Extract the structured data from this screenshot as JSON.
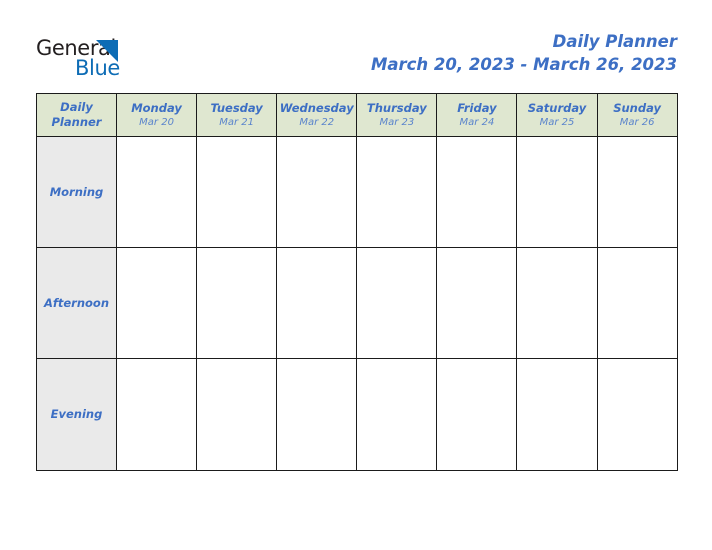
{
  "brand": {
    "name_dark": "General",
    "name_light": "Blue",
    "triangle_icon": "triangle-logo-mark",
    "dark_color": "#231f20",
    "light_color": "#0d6cb5"
  },
  "header": {
    "title": "Daily Planner",
    "date_range": "March 20, 2023 - March 26, 2023",
    "accent_color": "#3d6fc4"
  },
  "table": {
    "corner": {
      "line1": "Daily",
      "line2": "Planner"
    },
    "header_bg": "#dfe7d0",
    "label_bg": "#eaeaea",
    "border_color": "#1b1b1b",
    "columns": [
      {
        "day": "Monday",
        "date": "Mar 20"
      },
      {
        "day": "Tuesday",
        "date": "Mar 21"
      },
      {
        "day": "Wednesday",
        "date": "Mar 22"
      },
      {
        "day": "Thursday",
        "date": "Mar 23"
      },
      {
        "day": "Friday",
        "date": "Mar 24"
      },
      {
        "day": "Saturday",
        "date": "Mar 25"
      },
      {
        "day": "Sunday",
        "date": "Mar 26"
      }
    ],
    "rows": [
      {
        "label": "Morning",
        "cells": [
          "",
          "",
          "",
          "",
          "",
          "",
          ""
        ]
      },
      {
        "label": "Afternoon",
        "cells": [
          "",
          "",
          "",
          "",
          "",
          "",
          ""
        ]
      },
      {
        "label": "Evening",
        "cells": [
          "",
          "",
          "",
          "",
          "",
          "",
          ""
        ]
      }
    ]
  }
}
